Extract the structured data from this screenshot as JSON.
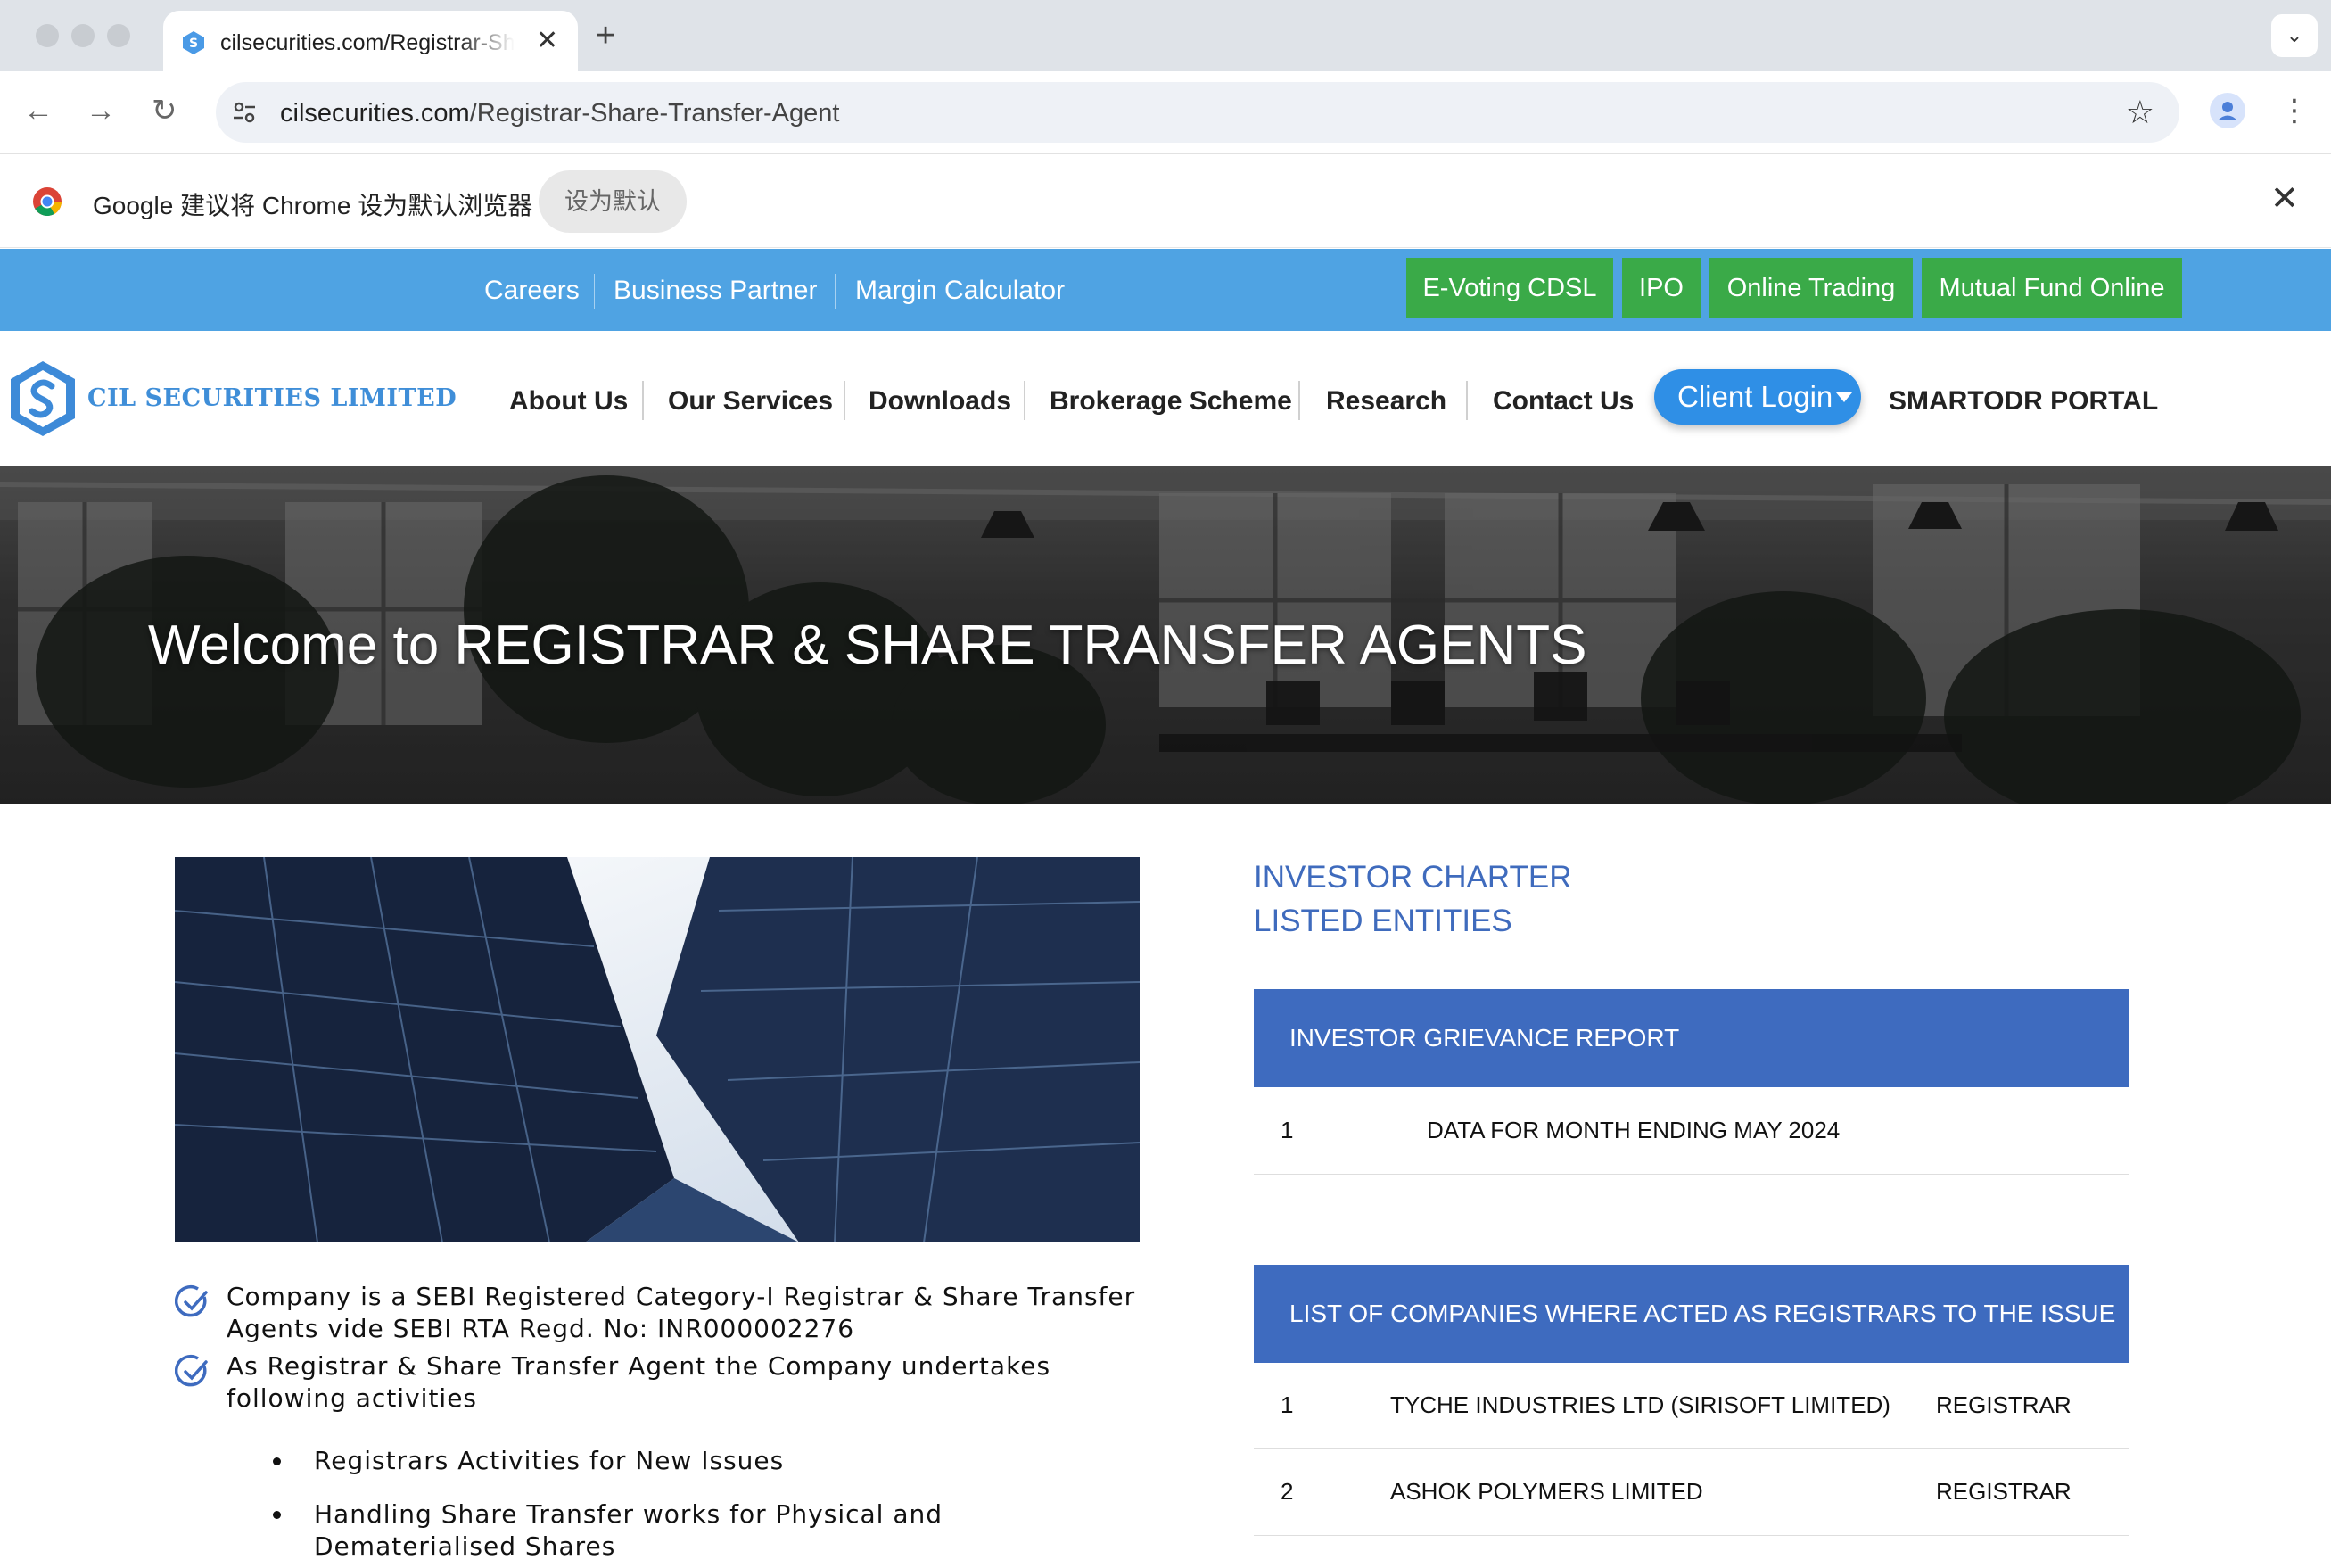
{
  "browser": {
    "tab_title": "cilsecurities.com/Registrar-Share-Transfer-Agent",
    "url_domain": "cilsecurities.com",
    "url_path": "/Registrar-Share-Transfer-Agent",
    "infobar_text": "Google 建议将 Chrome 设为默认浏览器",
    "infobar_button": "设为默认"
  },
  "topbar": {
    "links": [
      "Careers",
      "Business Partner",
      "Margin Calculator"
    ],
    "buttons": [
      "E-Voting CDSL",
      "IPO",
      "Online Trading",
      "Mutual Fund Online"
    ],
    "button_color": "#3aaa48",
    "background": "#4fa3e3"
  },
  "header": {
    "logo_text": "CIL SECURITIES LIMITED",
    "nav": [
      "About Us",
      "Our Services",
      "Downloads",
      "Brokerage Scheme",
      "Research",
      "Contact Us"
    ],
    "client_login": "Client Login",
    "smartodr": "SMARTODR PORTAL"
  },
  "hero": {
    "title": "Welcome to REGISTRAR & SHARE TRANSFER AGENTS"
  },
  "content": {
    "features": [
      "Company is a SEBI Registered Category-I Registrar & Share Transfer Agents vide SEBI RTA Regd. No: INR000002276",
      "As Registrar & Share Transfer Agent the Company undertakes following activities"
    ],
    "activities": [
      "Registrars Activities for New Issues",
      "Handling Share Transfer works for Physical and Dematerialised Shares"
    ]
  },
  "sidebar": {
    "links": [
      "INVESTOR CHARTER",
      "LISTED ENTITIES"
    ],
    "grievance": {
      "title": "INVESTOR GRIEVANCE REPORT",
      "rows": [
        {
          "num": "1",
          "text": "DATA FOR MONTH ENDING MAY 2024"
        }
      ]
    },
    "companies": {
      "title": "LIST OF COMPANIES WHERE ACTED AS REGISTRARS TO THE ISSUE",
      "rows": [
        {
          "num": "1",
          "name": "TYCHE INDUSTRIES LTD (SIRISOFT LIMITED)",
          "role": "REGISTRAR"
        },
        {
          "num": "2",
          "name": "ASHOK POLYMERS LIMITED",
          "role": "REGISTRAR"
        }
      ]
    },
    "accent": "#3e6bbf"
  }
}
